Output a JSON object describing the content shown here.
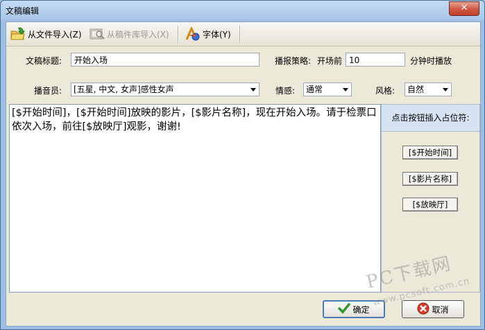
{
  "window": {
    "title": "文稿编辑",
    "close_label": "✕"
  },
  "toolbar": {
    "import_file": "从文件导入(Z)",
    "import_library": "从稿件库导入(X)",
    "font": "字体(Y)"
  },
  "form": {
    "doc_title_label": "文稿标题:",
    "doc_title_value": "开始入场",
    "strategy_label": "播报策略:",
    "strategy_prefix": "开场前",
    "strategy_minutes": "10",
    "strategy_suffix": "分钟时播放",
    "announcer_label": "播音员:",
    "announcer_value": "[五星, 中文, 女声]感性女声",
    "emotion_label": "情感:",
    "emotion_value": "通常",
    "style_label": "风格:",
    "style_value": "自然"
  },
  "editor": {
    "content": "[$开始时间]，[$开始时间]放映的影片，[$影片名称]，现在开始入场。请于检票口依次入场，前往[$放映厅]观影，谢谢!"
  },
  "placeholders": {
    "title": "点击按钮插入占位符:",
    "items": [
      "[$开始时间]",
      "[$影片名称]",
      "[$放映厅]"
    ]
  },
  "actions": {
    "ok": "确定",
    "cancel": "取消"
  },
  "watermark": {
    "main": "PC下载网",
    "sub": "www.pcsoft.com.cn"
  }
}
